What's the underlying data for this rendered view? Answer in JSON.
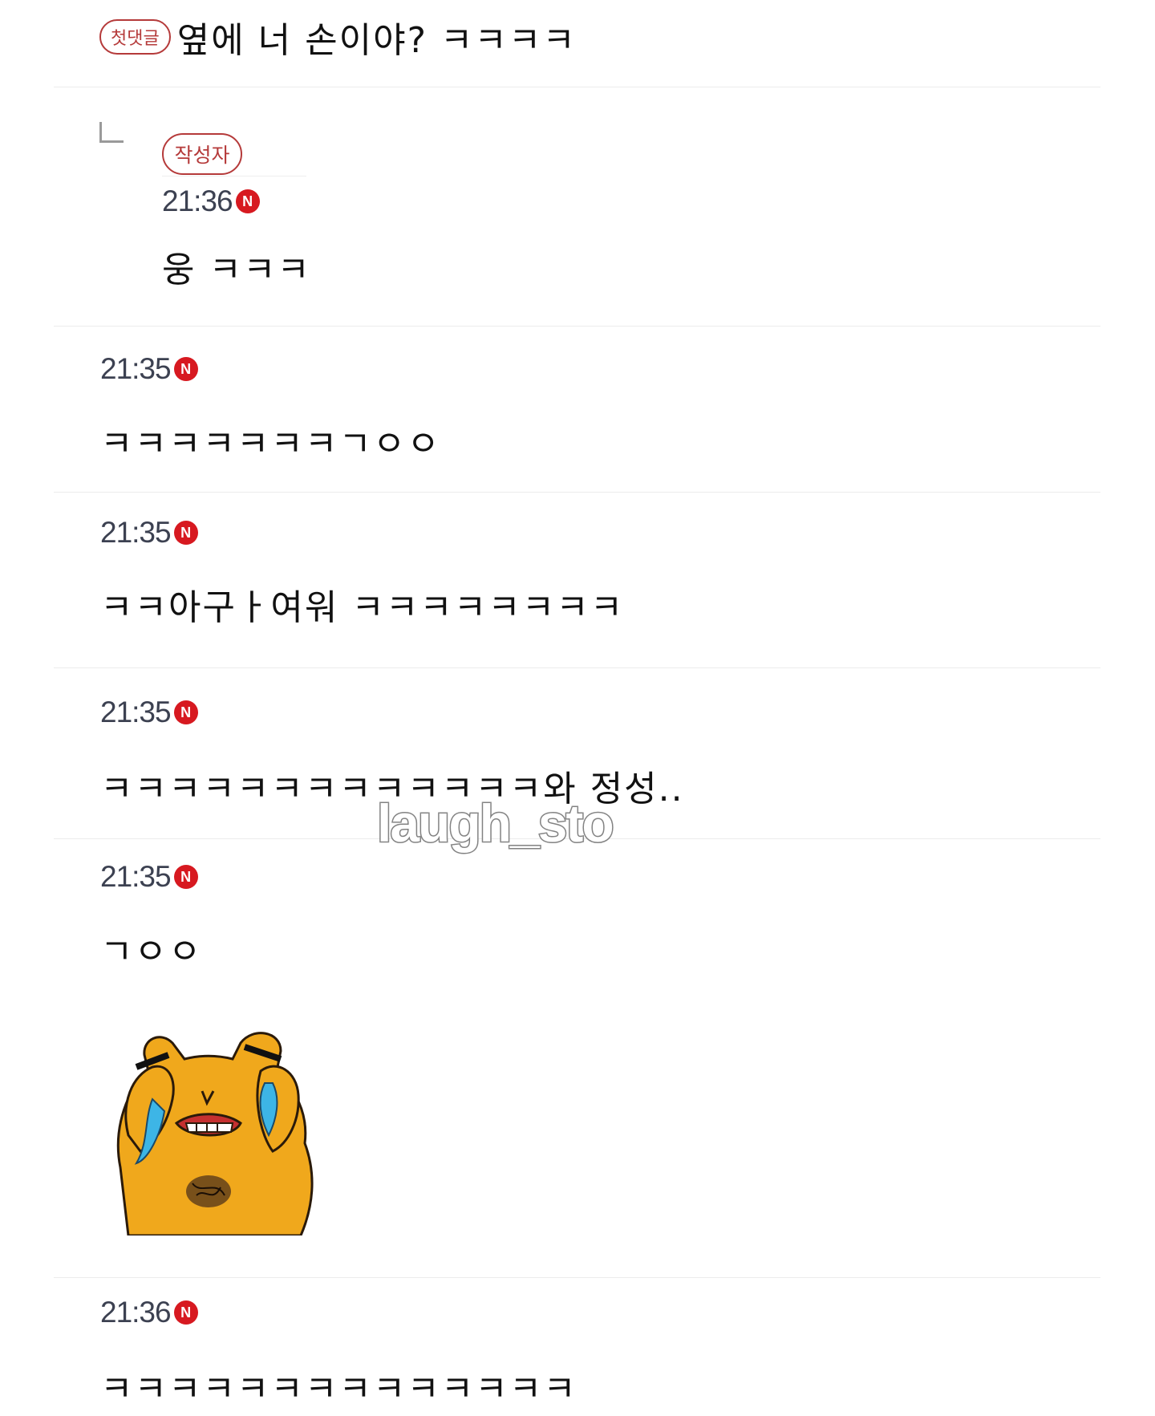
{
  "top_comment": {
    "badge": "첫댓글",
    "text": "옆에 너 손이야? ㅋㅋㅋㅋ"
  },
  "reply": {
    "badge": "작성자",
    "time": "21:36",
    "new_badge": "N",
    "text": "웅 ㅋㅋㅋ"
  },
  "comments": [
    {
      "time": "21:35",
      "new_badge": "N",
      "text": "ㅋㅋㅋㅋㅋㅋㅋㄱㅇㅇ"
    },
    {
      "time": "21:35",
      "new_badge": "N",
      "text": "ㅋㅋ아구ㅏ여워 ㅋㅋㅋㅋㅋㅋㅋㅋ"
    },
    {
      "time": "21:35",
      "new_badge": "N",
      "text": "ㅋㅋㅋㅋㅋㅋㅋㅋㅋㅋㅋㅋㅋ와 정성.."
    },
    {
      "time": "21:35",
      "new_badge": "N",
      "text": "ㄱㅇㅇ",
      "sticker": "crying-bear-sticker"
    },
    {
      "time": "21:36",
      "new_badge": "N",
      "text": "ㅋㅋㅋㅋㅋㅋㅋㅋㅋㅋㅋㅋㅋㅋ"
    }
  ],
  "watermark": "laugh_sto",
  "colors": {
    "badge_red": "#d71920",
    "pill_border": "#b53a3a",
    "time_text": "#3c4151",
    "divider": "#ececec",
    "sticker_yellow": "#f0a81c",
    "sticker_tears": "#3db5e6"
  }
}
